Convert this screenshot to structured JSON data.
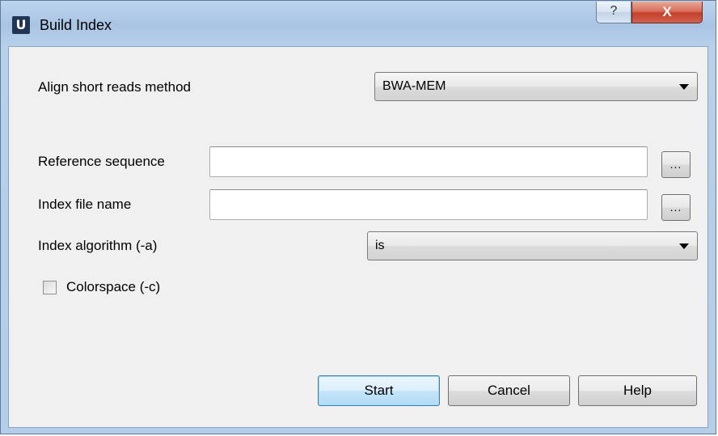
{
  "window": {
    "title": "Build Index",
    "app_icon_letter": "U",
    "help_glyph": "?",
    "close_glyph": "X"
  },
  "form": {
    "align_method_label": "Align short reads method",
    "align_method_value": "BWA-MEM",
    "reference_label": "Reference sequence",
    "reference_value": "",
    "index_file_label": "Index file name",
    "index_file_value": "",
    "browse_label": "...",
    "index_algorithm_label": "Index algorithm (-a)",
    "index_algorithm_value": "is",
    "colorspace_label": "Colorspace (-c)",
    "colorspace_checked": false
  },
  "buttons": {
    "start": "Start",
    "cancel": "Cancel",
    "help": "Help"
  }
}
